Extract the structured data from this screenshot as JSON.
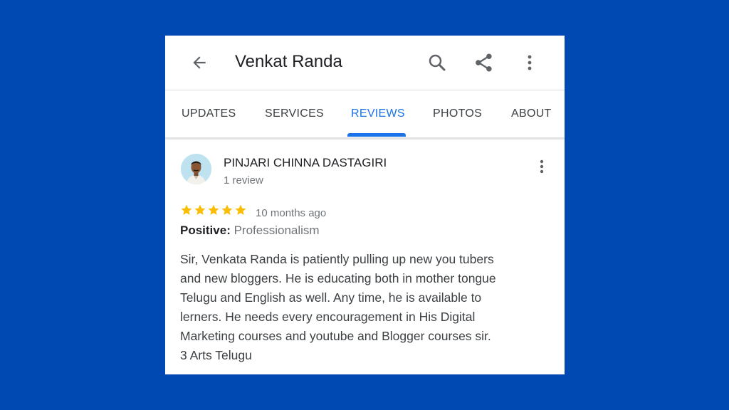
{
  "header": {
    "title": "Venkat Randa",
    "icons": [
      "arrow-back-icon",
      "search-icon",
      "share-icon",
      "more-vert-icon"
    ]
  },
  "tabs": [
    {
      "label": "UPDATES",
      "active": false
    },
    {
      "label": "SERVICES",
      "active": false
    },
    {
      "label": "REVIEWS",
      "active": true
    },
    {
      "label": "PHOTOS",
      "active": false
    },
    {
      "label": "ABOUT",
      "active": false
    }
  ],
  "review": {
    "reviewer_name": "PINJARI CHINNA DASTAGIRI",
    "reviewer_review_count": "1 review",
    "rating": 5,
    "rating_max": 5,
    "time": "10 months ago",
    "positive_label": "Positive:",
    "positive_value": "Professionalism",
    "text": "Sir, Venkata Randa is patiently pulling up new you tubers\nand new bloggers. He is educating both in mother tongue\nTelugu and English as well. Any time, he is available to\nlerners. He needs every encouragement in His Digital\nMarketing courses and youtube and Blogger courses sir.\n3 Arts Telugu"
  },
  "colors": {
    "background": "#0048b2",
    "accent": "#1a73e8",
    "star": "#fbbc04",
    "primary_text": "#202124",
    "secondary_text": "#70757a"
  }
}
